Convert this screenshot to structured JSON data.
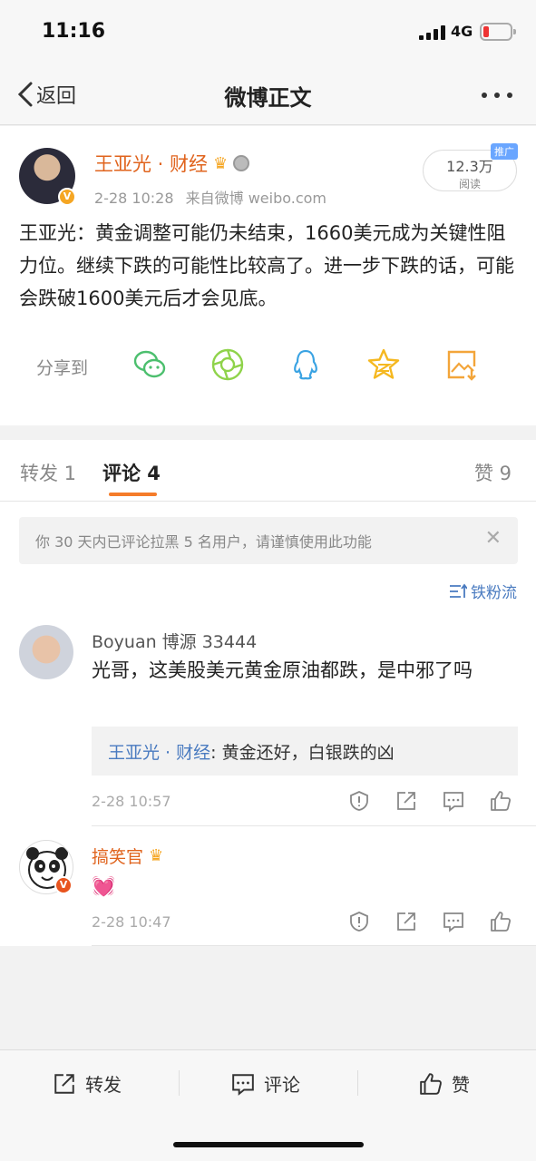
{
  "status": {
    "time": "11:16",
    "network": "4G"
  },
  "nav": {
    "back_label": "返回",
    "title": "微博正文"
  },
  "post": {
    "author": "王亚光 · 财经",
    "timestamp": "2-28 10:28",
    "source": "来自微博 weibo.com",
    "reads_count": "12.3万",
    "reads_label": "阅读",
    "promo_badge": "推广",
    "body": "王亚光：黄金调整可能仍未结束，1660美元成为关键性阻力位。继续下跌的可能性比较高了。进一步下跌的话，可能会跌破1600美元后才会见底。",
    "share_label": "分享到",
    "share_icons": [
      "wechat-icon",
      "moments-icon",
      "qq-icon",
      "qzone-icon",
      "save-image-icon"
    ]
  },
  "tabs": {
    "repost": "转发 1",
    "comments": "评论 4",
    "likes": "赞 9"
  },
  "notice": "你 30 天内已评论拉黑 5 名用户，请谨慎使用此功能",
  "sort_label": "铁粉流",
  "comments": [
    {
      "name": "Boyuan 博源 33444",
      "text": "光哥，这美股美元黄金原油都跌，是中邪了吗",
      "reply_author": "王亚光 · 财经",
      "reply_text": ": 黄金还好，白银跌的凶",
      "time": "2-28 10:57"
    },
    {
      "name": "搞笑官",
      "text": "💓",
      "time": "2-28 10:47"
    }
  ],
  "bottom": {
    "repost": "转发",
    "comment": "评论",
    "like": "赞"
  },
  "colors": {
    "accent": "#f57c2a",
    "link": "#4a7bc0",
    "author": "#e0641e"
  }
}
